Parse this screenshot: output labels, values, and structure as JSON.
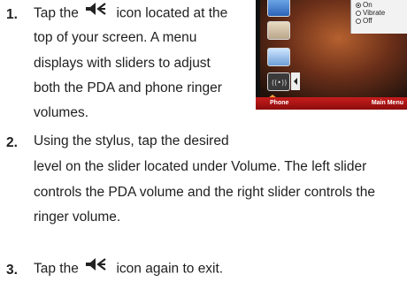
{
  "steps": [
    {
      "number": "1.",
      "lines": [
        [
          "Tap the",
          "icon located at the"
        ],
        "top of your screen. A menu",
        "displays with sliders to adjust",
        "both the PDA and phone ringer",
        "volumes."
      ]
    },
    {
      "number": "2.",
      "lines": [
        "Using the stylus, tap the desired",
        "level on the slider located under Volume. The left slider",
        "controls the PDA volume and the right slider controls the",
        "ringer volume."
      ]
    },
    {
      "number": "3.",
      "lines": [
        [
          "Tap the",
          "icon again to exit."
        ]
      ]
    }
  ],
  "screenshot": {
    "popup_options": [
      "On",
      "Vibrate",
      "Off"
    ],
    "softkey_left": "Phone",
    "softkey_right": "Main Menu"
  },
  "icons": {
    "inline_icon": "speaker-volume-icon"
  }
}
